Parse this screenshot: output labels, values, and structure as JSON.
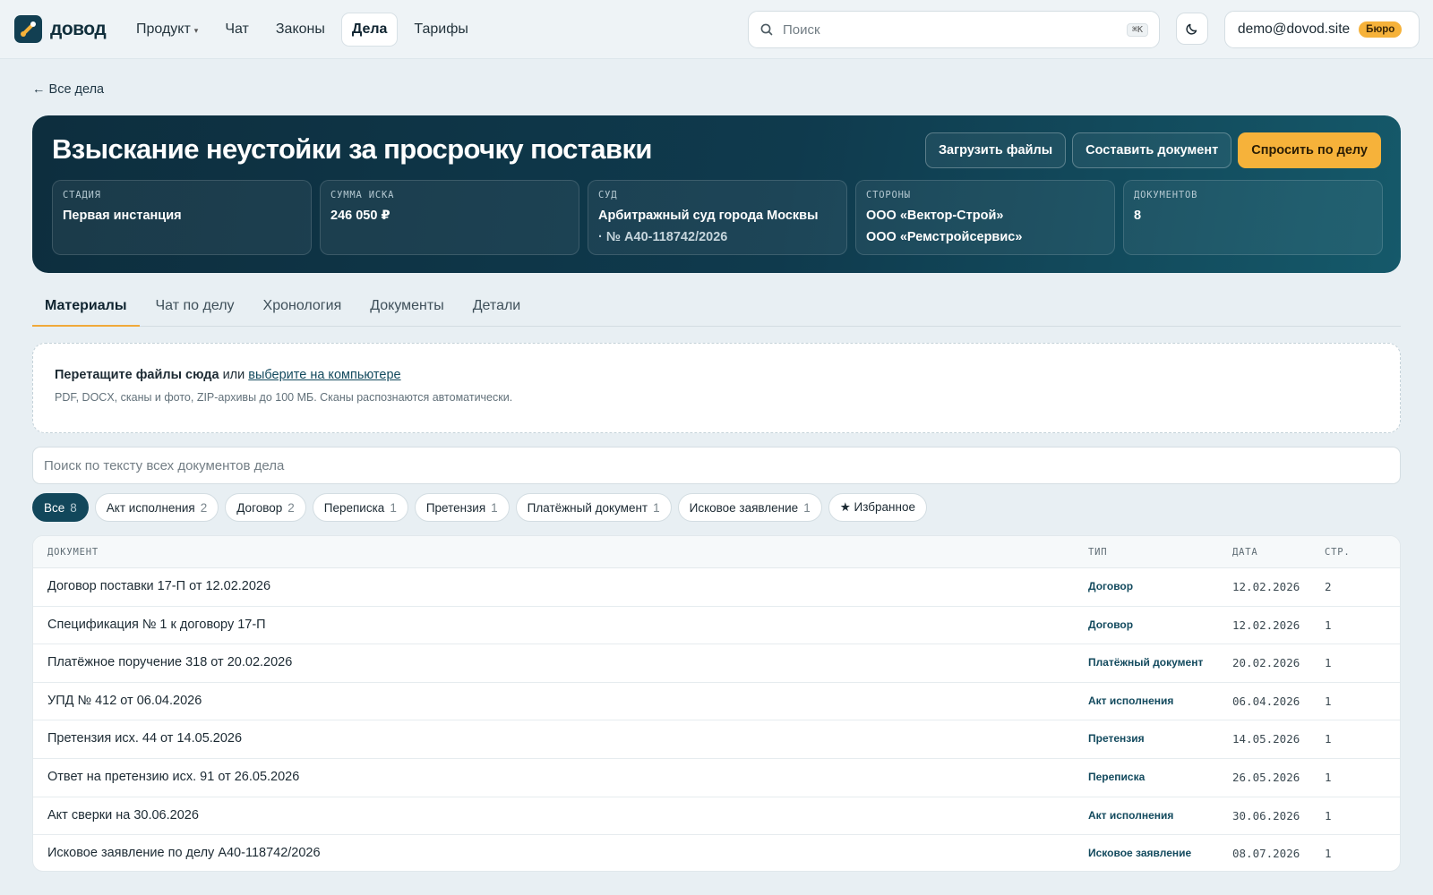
{
  "brand": {
    "name": "довод",
    "accent": "#f6b23a",
    "primary": "#12475b"
  },
  "nav": {
    "items": [
      {
        "label": "Продукт",
        "has_caret": true
      },
      {
        "label": "Чат"
      },
      {
        "label": "Законы"
      },
      {
        "label": "Дела",
        "active": true
      },
      {
        "label": "Тарифы"
      }
    ]
  },
  "search": {
    "placeholder": "Поиск",
    "shortcut": "⌘K"
  },
  "account": {
    "email": "demo@dovod.site",
    "plan": "Бюро"
  },
  "back_link": "← Все дела",
  "case": {
    "title": "Взыскание неустойки за просрочку поставки",
    "actions": {
      "upload": "Загрузить файлы",
      "compose": "Составить документ",
      "ask": "Спросить по делу"
    },
    "facts": [
      {
        "label": "Стадия",
        "value": "Первая инстанция"
      },
      {
        "label": "Сумма иска",
        "value": "246 050 ₽"
      },
      {
        "label": "Суд",
        "value": "Арбитражный суд города Москвы",
        "sub": "· № А40-118742/2026"
      },
      {
        "label": "Стороны",
        "value": "ООО «Вектор-Строй»",
        "value2": "ООО «Ремстройсервис»"
      },
      {
        "label": "Документов",
        "value": "8"
      }
    ]
  },
  "tabs": [
    {
      "label": "Материалы",
      "active": true
    },
    {
      "label": "Чат по делу"
    },
    {
      "label": "Хронология"
    },
    {
      "label": "Документы"
    },
    {
      "label": "Детали"
    }
  ],
  "dropzone": {
    "bold": "Перетащите файлы сюда",
    "or": " или ",
    "link": "выберите на компьютере",
    "hint": "PDF, DOCX, сканы и фото, ZIP-архивы до 100 МБ. Сканы распознаются автоматически."
  },
  "doc_search": {
    "placeholder": "Поиск по тексту всех документов дела"
  },
  "filters": [
    {
      "label": "Все",
      "count": "8",
      "active": true
    },
    {
      "label": "Акт исполнения",
      "count": "2"
    },
    {
      "label": "Договор",
      "count": "2"
    },
    {
      "label": "Переписка",
      "count": "1"
    },
    {
      "label": "Претензия",
      "count": "1"
    },
    {
      "label": "Платёжный документ",
      "count": "1"
    },
    {
      "label": "Исковое заявление",
      "count": "1"
    },
    {
      "label": "★ Избранное",
      "count": ""
    }
  ],
  "table": {
    "columns": {
      "name": "Документ",
      "type": "Тип",
      "date": "Дата",
      "pages": "Стр."
    },
    "rows": [
      {
        "name": "Договор поставки 17-П от 12.02.2026",
        "type": "Договор",
        "date": "12.02.2026",
        "pages": "2"
      },
      {
        "name": "Спецификация № 1 к договору 17-П",
        "type": "Договор",
        "date": "12.02.2026",
        "pages": "1"
      },
      {
        "name": "Платёжное поручение 318 от 20.02.2026",
        "type": "Платёжный документ",
        "date": "20.02.2026",
        "pages": "1"
      },
      {
        "name": "УПД № 412 от 06.04.2026",
        "type": "Акт исполнения",
        "date": "06.04.2026",
        "pages": "1"
      },
      {
        "name": "Претензия исх. 44 от 14.05.2026",
        "type": "Претензия",
        "date": "14.05.2026",
        "pages": "1"
      },
      {
        "name": "Ответ на претензию исх. 91 от 26.05.2026",
        "type": "Переписка",
        "date": "26.05.2026",
        "pages": "1"
      },
      {
        "name": "Акт сверки на 30.06.2026",
        "type": "Акт исполнения",
        "date": "30.06.2026",
        "pages": "1"
      },
      {
        "name": "Исковое заявление по делу А40-118742/2026",
        "type": "Исковое заявление",
        "date": "08.07.2026",
        "pages": "1"
      }
    ]
  }
}
